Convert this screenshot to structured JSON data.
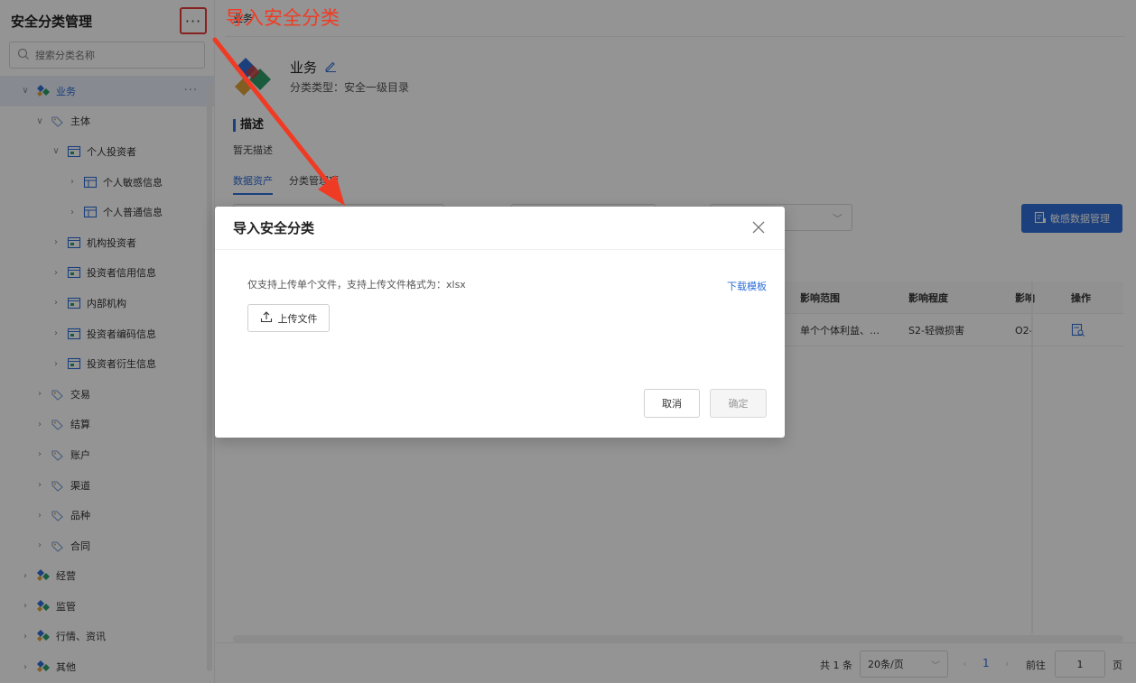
{
  "sidebar": {
    "title": "安全分类管理",
    "more_label": "···",
    "search_placeholder": "搜索分类名称",
    "items": [
      {
        "label": "业务",
        "level": 0,
        "icon": "business-icon",
        "chevron": "down",
        "active": true
      },
      {
        "label": "主体",
        "level": 1,
        "icon": "category-icon",
        "chevron": "down"
      },
      {
        "label": "个人投资者",
        "level": 2,
        "icon": "folder-icon",
        "chevron": "down"
      },
      {
        "label": "个人敏感信息",
        "level": 3,
        "icon": "table-icon",
        "chevron": "right"
      },
      {
        "label": "个人普通信息",
        "level": 3,
        "icon": "table-icon",
        "chevron": "right"
      },
      {
        "label": "机构投资者",
        "level": 2,
        "icon": "folder-icon",
        "chevron": "right"
      },
      {
        "label": "投资者信用信息",
        "level": 2,
        "icon": "folder-icon",
        "chevron": "right"
      },
      {
        "label": "内部机构",
        "level": 2,
        "icon": "folder-icon",
        "chevron": "right"
      },
      {
        "label": "投资者编码信息",
        "level": 2,
        "icon": "folder-icon",
        "chevron": "right"
      },
      {
        "label": "投资者衍生信息",
        "level": 2,
        "icon": "folder-icon",
        "chevron": "right"
      },
      {
        "label": "交易",
        "level": 1,
        "icon": "category-icon",
        "chevron": "right"
      },
      {
        "label": "结算",
        "level": 1,
        "icon": "category-icon",
        "chevron": "right"
      },
      {
        "label": "账户",
        "level": 1,
        "icon": "category-icon",
        "chevron": "right"
      },
      {
        "label": "渠道",
        "level": 1,
        "icon": "category-icon",
        "chevron": "right"
      },
      {
        "label": "品种",
        "level": 1,
        "icon": "category-icon",
        "chevron": "right"
      },
      {
        "label": "合同",
        "level": 1,
        "icon": "category-icon",
        "chevron": "right"
      },
      {
        "label": "经营",
        "level": 0,
        "icon": "business-icon",
        "chevron": "right"
      },
      {
        "label": "监管",
        "level": 0,
        "icon": "business-icon",
        "chevron": "right"
      },
      {
        "label": "行情、资讯",
        "level": 0,
        "icon": "business-icon",
        "chevron": "right"
      },
      {
        "label": "其他",
        "level": 0,
        "icon": "business-icon",
        "chevron": "right"
      }
    ]
  },
  "main": {
    "breadcrumb": "业务",
    "title": "业务",
    "subtitle": "分类类型：安全一级目录",
    "desc_heading": "描述",
    "desc_body": "暂无描述",
    "tabs": [
      {
        "label": "数据资产",
        "active": true
      },
      {
        "label": "分类管理项",
        "active": false
      }
    ],
    "sensitive_button": "敏感数据管理",
    "table": {
      "headers": [
        "影响范围",
        "影响程度",
        "影响",
        "操作"
      ],
      "rows": [
        [
          "单个个体利益、…",
          "S2-轻微损害",
          "O2-"
        ]
      ]
    },
    "pagination": {
      "total": "共 1 条",
      "page_size": "20条/页",
      "current": "1",
      "goto_label": "前往",
      "goto_value": "1",
      "unit": "页"
    }
  },
  "modal": {
    "title": "导入安全分类",
    "note": "仅支持上传单个文件，支持上传文件格式为：xlsx",
    "download_link": "下载模板",
    "upload_button": "上传文件",
    "cancel_button": "取消",
    "confirm_button": "确定"
  },
  "annotation": {
    "text": "导入安全分类",
    "color": "#f03b24"
  },
  "colors": {
    "primary": "#2f6fd8",
    "annotation_red": "#f03b24"
  }
}
